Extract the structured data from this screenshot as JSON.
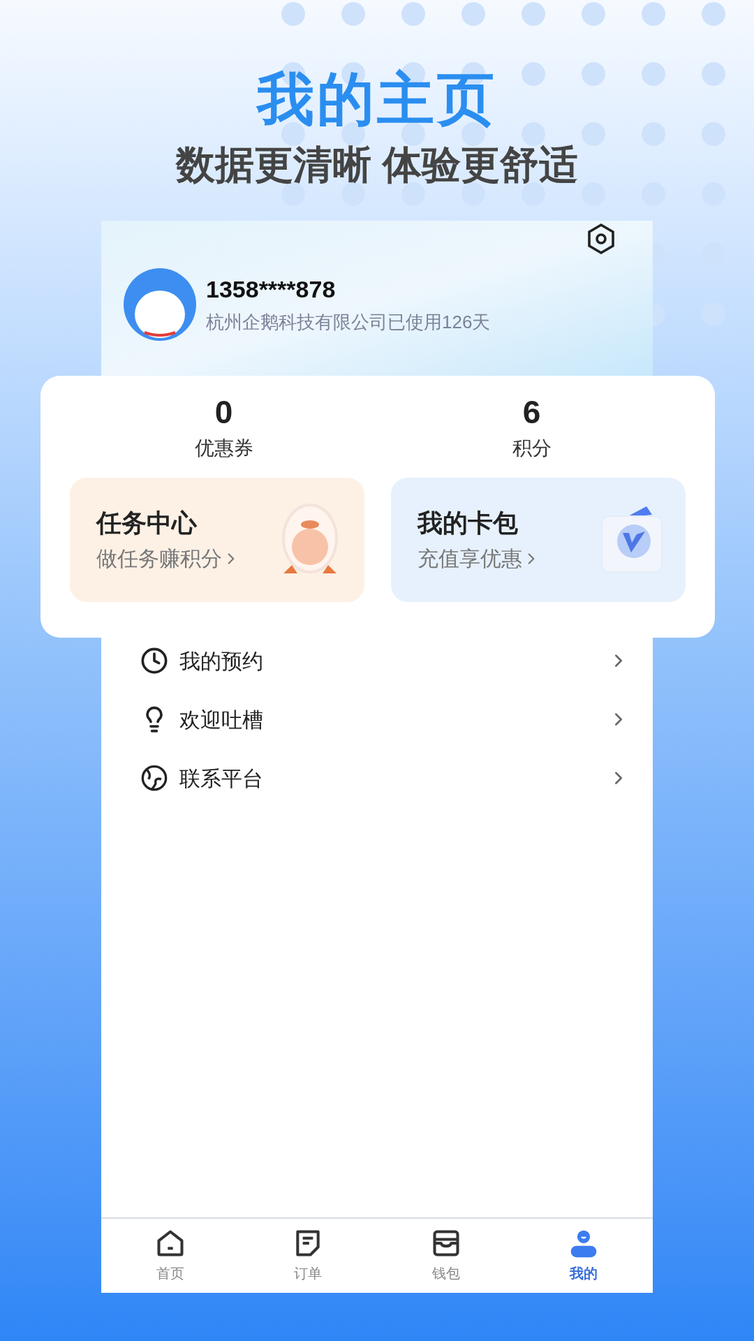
{
  "hero": {
    "title": "我的主页",
    "subtitle": "数据更清晰 体验更舒适"
  },
  "profile": {
    "phone": "1358****878",
    "note": "杭州企鹅科技有限公司已使用126天"
  },
  "stats": [
    {
      "value": "0",
      "label": "优惠券"
    },
    {
      "value": "6",
      "label": "积分"
    }
  ],
  "promo_cards": [
    {
      "kind": "tasks",
      "title": "任务中心",
      "subtitle": "做任务赚积分"
    },
    {
      "kind": "wallet",
      "title": "我的卡包",
      "subtitle": "充值享优惠"
    }
  ],
  "menu": [
    {
      "kind": "clock",
      "label": "我的预约"
    },
    {
      "kind": "bulb",
      "label": "欢迎吐槽"
    },
    {
      "kind": "contact",
      "label": "联系平台"
    }
  ],
  "tabs": [
    {
      "kind": "home",
      "label": "首页",
      "selected": false
    },
    {
      "kind": "orders",
      "label": "订单",
      "selected": false
    },
    {
      "kind": "wallet",
      "label": "钱包",
      "selected": false
    },
    {
      "kind": "me",
      "label": "我的",
      "selected": true
    }
  ]
}
